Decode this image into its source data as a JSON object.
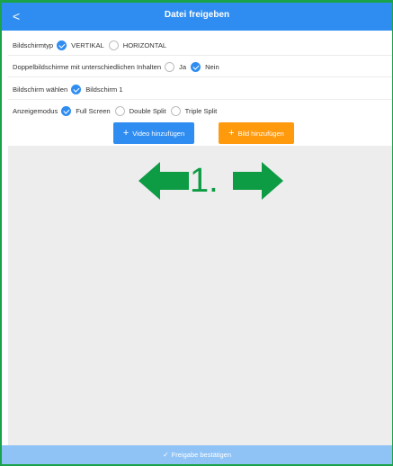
{
  "header": {
    "back_icon": "chevron-left-icon",
    "back_glyph": "<",
    "title": "Datei freigeben"
  },
  "settings": {
    "screen_type": {
      "label": "Bildschirmtyp",
      "options": [
        {
          "label": "VERTIKAL",
          "selected": true
        },
        {
          "label": "HORIZONTAL",
          "selected": false
        }
      ]
    },
    "dual_screen": {
      "label": "Doppelbildschirme mit unterschiedlichen Inhalten",
      "options": [
        {
          "label": "Ja",
          "selected": false
        },
        {
          "label": "Nein",
          "selected": true
        }
      ]
    },
    "screen_select": {
      "label": "Bildschirm wählen",
      "options": [
        {
          "label": "Bildschirm 1",
          "selected": true
        }
      ]
    },
    "display_mode": {
      "label": "Anzeigemodus",
      "options": [
        {
          "label": "Full Screen",
          "selected": true
        },
        {
          "label": "Double Split",
          "selected": false
        },
        {
          "label": "Triple Split",
          "selected": false
        }
      ]
    }
  },
  "actions": {
    "add_video": {
      "glyph": "+",
      "label": "Video hinzufügen"
    },
    "add_image": {
      "glyph": "+",
      "label": "Bild hinzufügen"
    }
  },
  "canvas": {
    "marker_text": "1.",
    "arrow_color": "#0d9b44"
  },
  "footer": {
    "check_glyph": "✓",
    "label": "Freigabe bestätigen"
  },
  "colors": {
    "accent": "#2f8df1",
    "orange": "#ff9a0d",
    "footer": "#8fc3f6",
    "canvas": "#ededed",
    "frame": "#1aa34a"
  }
}
